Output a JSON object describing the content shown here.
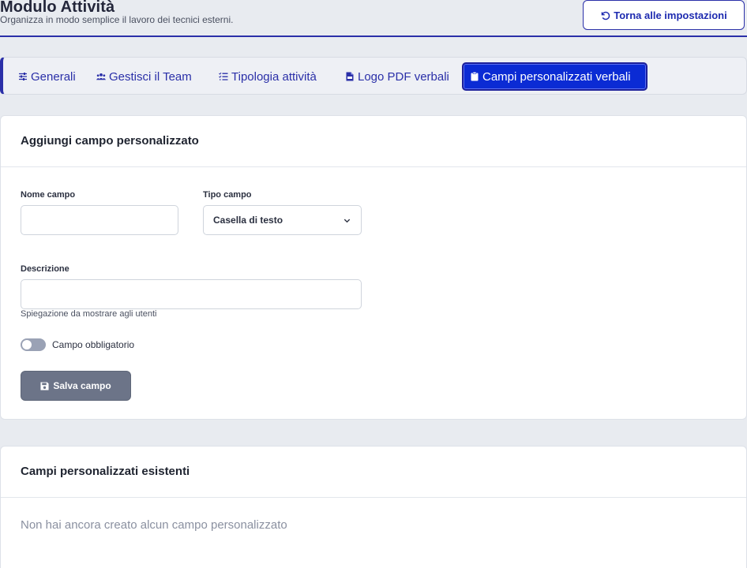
{
  "header": {
    "title": "Modulo Attività",
    "subtitle": "Organizza in modo semplice il lavoro dei tecnici esterni.",
    "back_label": "Torna alle impostazioni"
  },
  "tabs": [
    {
      "label": "Generali",
      "icon": "sliders-icon",
      "active": false
    },
    {
      "label": "Gestisci il Team",
      "icon": "users-icon",
      "active": false
    },
    {
      "label": "Tipologia attività",
      "icon": "list-check-icon",
      "active": false
    },
    {
      "label": "Logo PDF verbali",
      "icon": "file-pdf-icon",
      "active": false
    },
    {
      "label": "Campi personalizzati verbali",
      "icon": "clipboard-icon",
      "active": true
    }
  ],
  "add_field_card": {
    "title": "Aggiungi campo personalizzato",
    "name_label": "Nome campo",
    "name_value": "",
    "type_label": "Tipo campo",
    "type_selected": "Casella di testo",
    "description_label": "Descrizione",
    "description_value": "",
    "description_help": "Spiegazione da mostrare agli utenti",
    "required_label": "Campo obbligatorio",
    "required_on": false,
    "save_label": "Salva campo"
  },
  "existing_card": {
    "title": "Campi personalizzati esistenti",
    "empty_text": "Non hai ancora creato alcun campo personalizzato"
  },
  "colors": {
    "accent": "#2a2fa8",
    "active_tab": "#0b2bd4",
    "button_gray": "#6c7488"
  }
}
